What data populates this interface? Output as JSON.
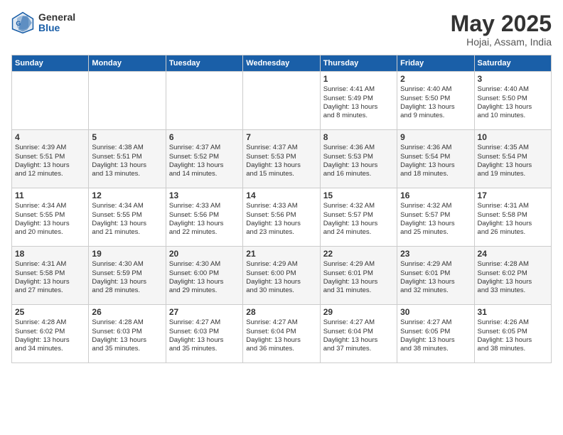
{
  "logo": {
    "general": "General",
    "blue": "Blue"
  },
  "header": {
    "month": "May 2025",
    "location": "Hojai, Assam, India"
  },
  "weekdays": [
    "Sunday",
    "Monday",
    "Tuesday",
    "Wednesday",
    "Thursday",
    "Friday",
    "Saturday"
  ],
  "weeks": [
    [
      {
        "day": "",
        "info": ""
      },
      {
        "day": "",
        "info": ""
      },
      {
        "day": "",
        "info": ""
      },
      {
        "day": "",
        "info": ""
      },
      {
        "day": "1",
        "info": "Sunrise: 4:41 AM\nSunset: 5:49 PM\nDaylight: 13 hours\nand 8 minutes."
      },
      {
        "day": "2",
        "info": "Sunrise: 4:40 AM\nSunset: 5:50 PM\nDaylight: 13 hours\nand 9 minutes."
      },
      {
        "day": "3",
        "info": "Sunrise: 4:40 AM\nSunset: 5:50 PM\nDaylight: 13 hours\nand 10 minutes."
      }
    ],
    [
      {
        "day": "4",
        "info": "Sunrise: 4:39 AM\nSunset: 5:51 PM\nDaylight: 13 hours\nand 12 minutes."
      },
      {
        "day": "5",
        "info": "Sunrise: 4:38 AM\nSunset: 5:51 PM\nDaylight: 13 hours\nand 13 minutes."
      },
      {
        "day": "6",
        "info": "Sunrise: 4:37 AM\nSunset: 5:52 PM\nDaylight: 13 hours\nand 14 minutes."
      },
      {
        "day": "7",
        "info": "Sunrise: 4:37 AM\nSunset: 5:53 PM\nDaylight: 13 hours\nand 15 minutes."
      },
      {
        "day": "8",
        "info": "Sunrise: 4:36 AM\nSunset: 5:53 PM\nDaylight: 13 hours\nand 16 minutes."
      },
      {
        "day": "9",
        "info": "Sunrise: 4:36 AM\nSunset: 5:54 PM\nDaylight: 13 hours\nand 18 minutes."
      },
      {
        "day": "10",
        "info": "Sunrise: 4:35 AM\nSunset: 5:54 PM\nDaylight: 13 hours\nand 19 minutes."
      }
    ],
    [
      {
        "day": "11",
        "info": "Sunrise: 4:34 AM\nSunset: 5:55 PM\nDaylight: 13 hours\nand 20 minutes."
      },
      {
        "day": "12",
        "info": "Sunrise: 4:34 AM\nSunset: 5:55 PM\nDaylight: 13 hours\nand 21 minutes."
      },
      {
        "day": "13",
        "info": "Sunrise: 4:33 AM\nSunset: 5:56 PM\nDaylight: 13 hours\nand 22 minutes."
      },
      {
        "day": "14",
        "info": "Sunrise: 4:33 AM\nSunset: 5:56 PM\nDaylight: 13 hours\nand 23 minutes."
      },
      {
        "day": "15",
        "info": "Sunrise: 4:32 AM\nSunset: 5:57 PM\nDaylight: 13 hours\nand 24 minutes."
      },
      {
        "day": "16",
        "info": "Sunrise: 4:32 AM\nSunset: 5:57 PM\nDaylight: 13 hours\nand 25 minutes."
      },
      {
        "day": "17",
        "info": "Sunrise: 4:31 AM\nSunset: 5:58 PM\nDaylight: 13 hours\nand 26 minutes."
      }
    ],
    [
      {
        "day": "18",
        "info": "Sunrise: 4:31 AM\nSunset: 5:58 PM\nDaylight: 13 hours\nand 27 minutes."
      },
      {
        "day": "19",
        "info": "Sunrise: 4:30 AM\nSunset: 5:59 PM\nDaylight: 13 hours\nand 28 minutes."
      },
      {
        "day": "20",
        "info": "Sunrise: 4:30 AM\nSunset: 6:00 PM\nDaylight: 13 hours\nand 29 minutes."
      },
      {
        "day": "21",
        "info": "Sunrise: 4:29 AM\nSunset: 6:00 PM\nDaylight: 13 hours\nand 30 minutes."
      },
      {
        "day": "22",
        "info": "Sunrise: 4:29 AM\nSunset: 6:01 PM\nDaylight: 13 hours\nand 31 minutes."
      },
      {
        "day": "23",
        "info": "Sunrise: 4:29 AM\nSunset: 6:01 PM\nDaylight: 13 hours\nand 32 minutes."
      },
      {
        "day": "24",
        "info": "Sunrise: 4:28 AM\nSunset: 6:02 PM\nDaylight: 13 hours\nand 33 minutes."
      }
    ],
    [
      {
        "day": "25",
        "info": "Sunrise: 4:28 AM\nSunset: 6:02 PM\nDaylight: 13 hours\nand 34 minutes."
      },
      {
        "day": "26",
        "info": "Sunrise: 4:28 AM\nSunset: 6:03 PM\nDaylight: 13 hours\nand 35 minutes."
      },
      {
        "day": "27",
        "info": "Sunrise: 4:27 AM\nSunset: 6:03 PM\nDaylight: 13 hours\nand 35 minutes."
      },
      {
        "day": "28",
        "info": "Sunrise: 4:27 AM\nSunset: 6:04 PM\nDaylight: 13 hours\nand 36 minutes."
      },
      {
        "day": "29",
        "info": "Sunrise: 4:27 AM\nSunset: 6:04 PM\nDaylight: 13 hours\nand 37 minutes."
      },
      {
        "day": "30",
        "info": "Sunrise: 4:27 AM\nSunset: 6:05 PM\nDaylight: 13 hours\nand 38 minutes."
      },
      {
        "day": "31",
        "info": "Sunrise: 4:26 AM\nSunset: 6:05 PM\nDaylight: 13 hours\nand 38 minutes."
      }
    ]
  ]
}
